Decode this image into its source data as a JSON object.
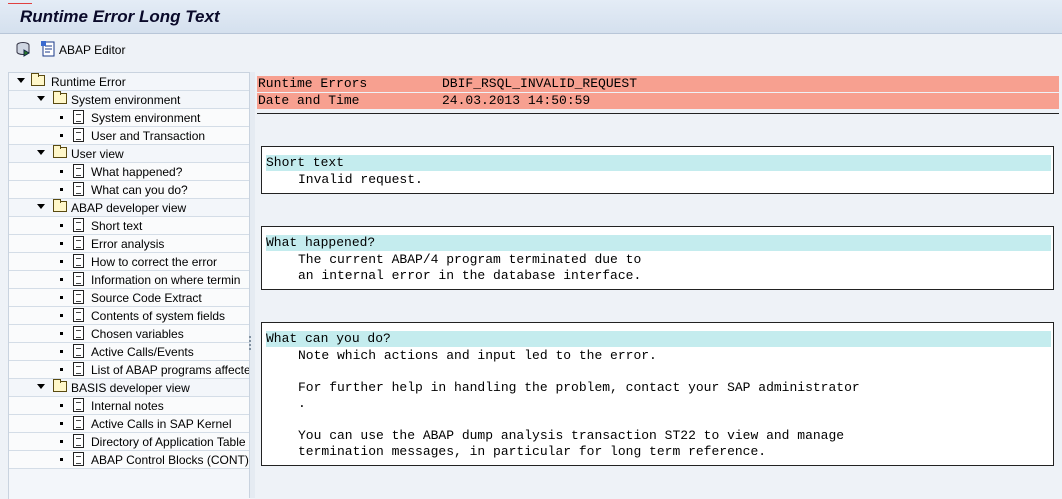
{
  "window": {
    "title": "Runtime Error Long Text"
  },
  "toolbar": {
    "abap_editor_label": "ABAP Editor",
    "icons": [
      "execute-icon",
      "abap-editor-icon"
    ]
  },
  "tree": {
    "items": [
      {
        "label": "Runtime Error",
        "level": 0,
        "kind": "folder"
      },
      {
        "label": "System environment",
        "level": 1,
        "kind": "folder"
      },
      {
        "label": "System environment",
        "level": 2,
        "kind": "doc"
      },
      {
        "label": "User and Transaction",
        "level": 2,
        "kind": "doc"
      },
      {
        "label": "User view",
        "level": 1,
        "kind": "folder"
      },
      {
        "label": "What happened?",
        "level": 2,
        "kind": "doc"
      },
      {
        "label": "What can you do?",
        "level": 2,
        "kind": "doc"
      },
      {
        "label": "ABAP developer view",
        "level": 1,
        "kind": "folder"
      },
      {
        "label": "Short text",
        "level": 2,
        "kind": "doc"
      },
      {
        "label": "Error analysis",
        "level": 2,
        "kind": "doc"
      },
      {
        "label": "How to correct the error",
        "level": 2,
        "kind": "doc"
      },
      {
        "label": "Information on where termin",
        "level": 2,
        "kind": "doc"
      },
      {
        "label": "Source Code Extract",
        "level": 2,
        "kind": "doc"
      },
      {
        "label": "Contents of system fields",
        "level": 2,
        "kind": "doc"
      },
      {
        "label": "Chosen variables",
        "level": 2,
        "kind": "doc"
      },
      {
        "label": "Active Calls/Events",
        "level": 2,
        "kind": "doc"
      },
      {
        "label": "List of ABAP programs affecte",
        "level": 2,
        "kind": "doc"
      },
      {
        "label": "BASIS developer view",
        "level": 1,
        "kind": "folder"
      },
      {
        "label": "Internal notes",
        "level": 2,
        "kind": "doc"
      },
      {
        "label": "Active Calls in SAP Kernel",
        "level": 2,
        "kind": "doc"
      },
      {
        "label": "Directory of Application Table",
        "level": 2,
        "kind": "doc"
      },
      {
        "label": "ABAP Control Blocks (CONT)",
        "level": 2,
        "kind": "doc"
      }
    ]
  },
  "header": {
    "rows": [
      {
        "label": "Runtime Errors",
        "value": "DBIF_RSQL_INVALID_REQUEST"
      },
      {
        "label": "Date and Time",
        "value": "24.03.2013 14:50:59"
      }
    ]
  },
  "sections": {
    "short_text": {
      "heading": "Short text",
      "lines": [
        "Invalid request."
      ]
    },
    "what_happened": {
      "heading": "What happened?",
      "lines": [
        "The current ABAP/4 program terminated due to",
        "an internal error in the database interface."
      ]
    },
    "what_can_you_do": {
      "heading": "What can you do?",
      "lines": [
        "Note which actions and input led to the error.",
        "",
        "For further help in handling the problem, contact your SAP administrator",
        ".",
        "",
        "You can use the ABAP dump analysis transaction ST22 to view and manage",
        "termination messages, in particular for long term reference."
      ]
    }
  },
  "colors": {
    "header_bg": "#f7a090",
    "section_head_bg": "#c4ecee"
  }
}
